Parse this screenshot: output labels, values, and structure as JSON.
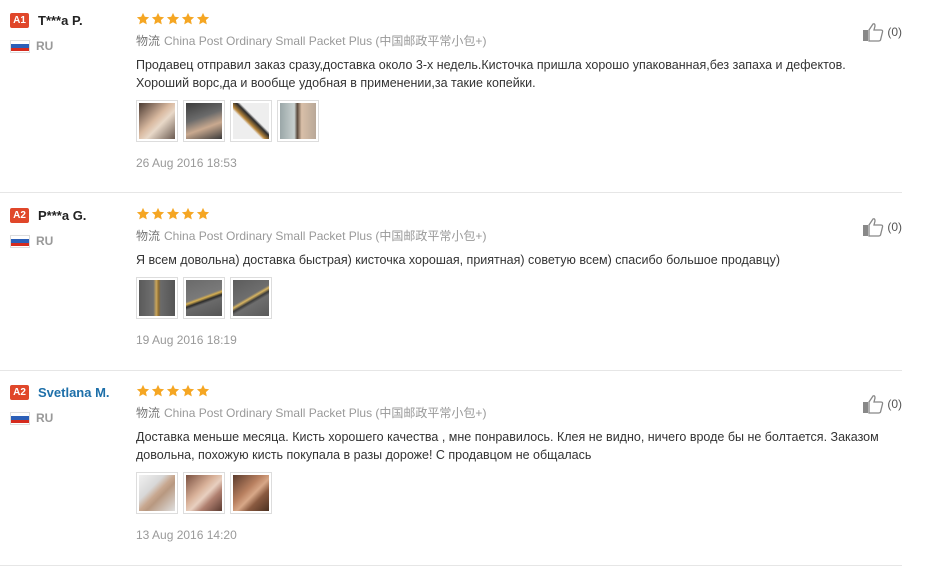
{
  "reviews": [
    {
      "level": "A1",
      "name": "T***a P.",
      "country": "RU",
      "stars": 5,
      "logistics_label": "物流",
      "logistics": "China Post Ordinary Small Packet Plus (中国邮政平常小包+)",
      "text": "Продавец отправил заказ сразу,доставка около 3-х недель.Кисточка пришла хорошо упакованная,без запаха и дефектов. Хороший ворс,да и вообще удобная в применении,за такие копейки.",
      "photos": 4,
      "date": "26 Aug 2016 18:53",
      "helpful": "(0)"
    },
    {
      "level": "A2",
      "name": "P***a G.",
      "country": "RU",
      "stars": 5,
      "logistics_label": "物流",
      "logistics": "China Post Ordinary Small Packet Plus (中国邮政平常小包+)",
      "text": "Я всем довольна) доставка быстрая) кисточка хорошая, приятная) советую всем) спасибо большое продавцу)",
      "photos": 3,
      "date": "19 Aug 2016 18:19",
      "helpful": "(0)"
    },
    {
      "level": "A2",
      "name": "Svetlana M.",
      "country": "RU",
      "stars": 5,
      "logistics_label": "物流",
      "logistics": "China Post Ordinary Small Packet Plus (中国邮政平常小包+)",
      "text": "Доставка меньше месяца. Кисть хорошего качества , мне понравилось. Клея не видно, ничего вроде бы не болтается. Заказом довольна, похожую кисть покупала в разы дороже! С продавцом не общалась",
      "photos": 3,
      "date": "13 Aug 2016 14:20",
      "helpful": "(0)"
    }
  ],
  "colors": {
    "level_badge": "#e0472a",
    "star": "#f5a623",
    "link_name": "#1d6fa9"
  },
  "icons": {
    "helpful": "thumbs-up-icon",
    "country": "russia-flag-icon",
    "rating": "star-icon"
  }
}
